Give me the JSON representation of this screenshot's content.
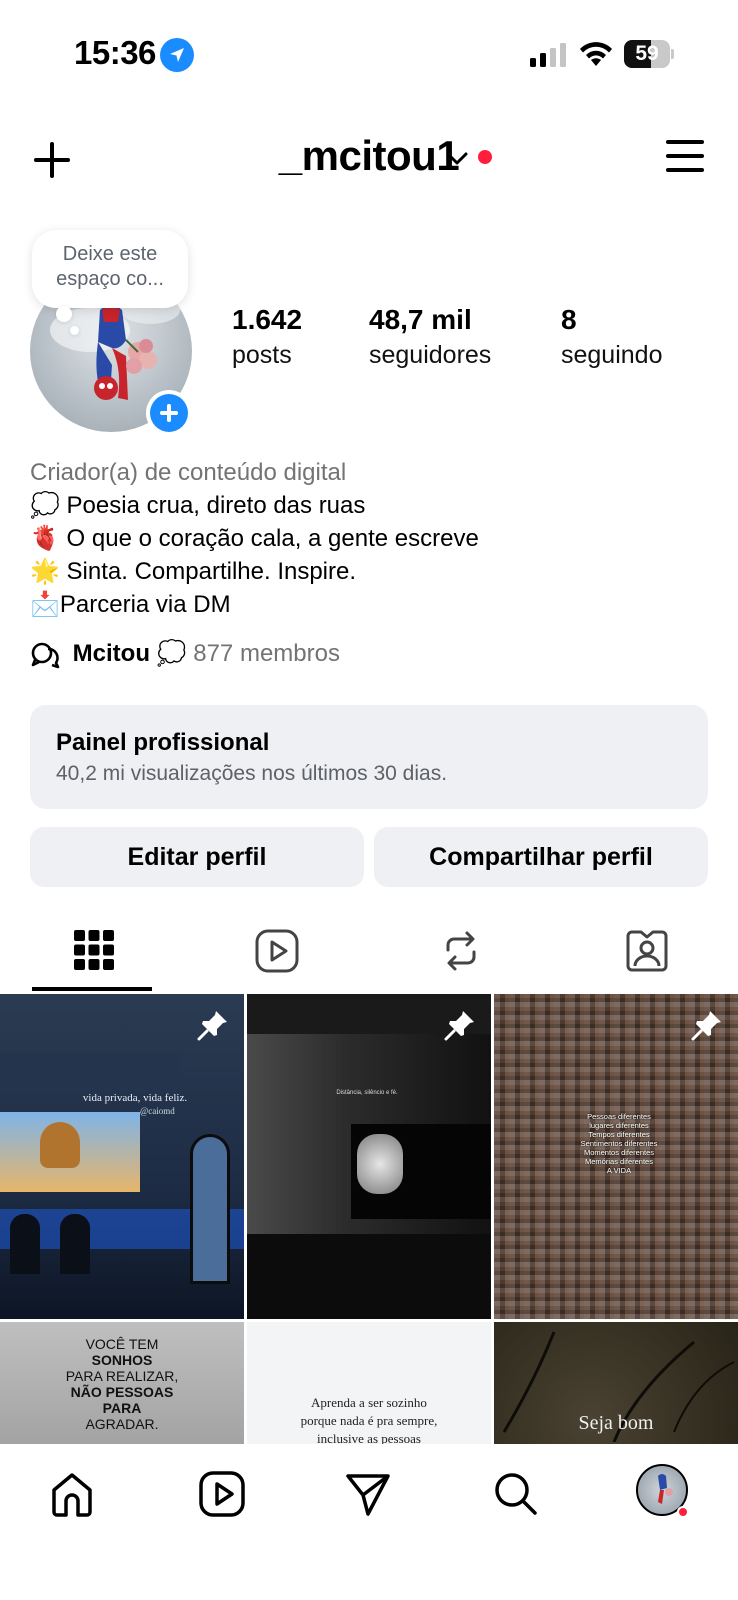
{
  "status_bar": {
    "time": "15:36",
    "battery_level": "59",
    "battery_fraction": 0.59,
    "signal_bars": 2
  },
  "header": {
    "username": "_mcitou1",
    "has_notification_dot": true
  },
  "profile": {
    "note": "Deixe este espaço co...",
    "stats": [
      {
        "value": "1.642",
        "label": "posts"
      },
      {
        "value": "48,7 mil",
        "label": "seguidores"
      },
      {
        "value": "8",
        "label": "seguindo"
      }
    ],
    "category": "Criador(a) de conteúdo digital",
    "bio_lines": [
      "💭 Poesia crua, direto das ruas",
      "🫀 O que o coração cala, a gente escreve",
      "🌟 Sinta. Compartilhe. Inspire.",
      "📩Parceria via DM"
    ],
    "community": {
      "name": "Mcitou",
      "emoji": "💭",
      "members": "877 membros"
    }
  },
  "pro_panel": {
    "title": "Painel profissional",
    "subtitle": "40,2 mi visualizações nos últimos 30 dias."
  },
  "buttons": {
    "edit": "Editar perfil",
    "share": "Compartilhar perfil"
  },
  "tabs": [
    {
      "icon": "grid-icon",
      "active": true
    },
    {
      "icon": "reels-icon",
      "active": false
    },
    {
      "icon": "reposts-icon",
      "active": false
    },
    {
      "icon": "tagged-icon",
      "active": false
    }
  ],
  "grid": {
    "posts": [
      {
        "text": "vida privada, vida feliz.",
        "handle": "@caiomd",
        "pinned": true
      },
      {
        "text": "Distância, silêncio e fé.",
        "pinned": true
      },
      {
        "text_lines": [
          "Pessoas diferentes",
          "lugares diferentes",
          "Tempos diferentes",
          "Sentimentos diferentes",
          "Momentos diferentes",
          "Memórias diferentes",
          "A VIDA"
        ],
        "pinned": true
      },
      {
        "text_lines": [
          "VOCÊ TEM",
          "SONHOS",
          "PARA REALIZAR,",
          "NÃO PESSOAS",
          "PARA",
          "AGRADAR."
        ],
        "pinned": false
      },
      {
        "text_lines": [
          "Aprenda a ser sozinho",
          "porque nada é pra sempre,",
          "inclusive as pessoas"
        ],
        "pinned": false
      },
      {
        "text": "Seja bom",
        "pinned": false
      }
    ]
  },
  "bottom_nav": [
    "home-icon",
    "reels-icon",
    "messages-icon",
    "search-icon",
    "profile-avatar"
  ]
}
